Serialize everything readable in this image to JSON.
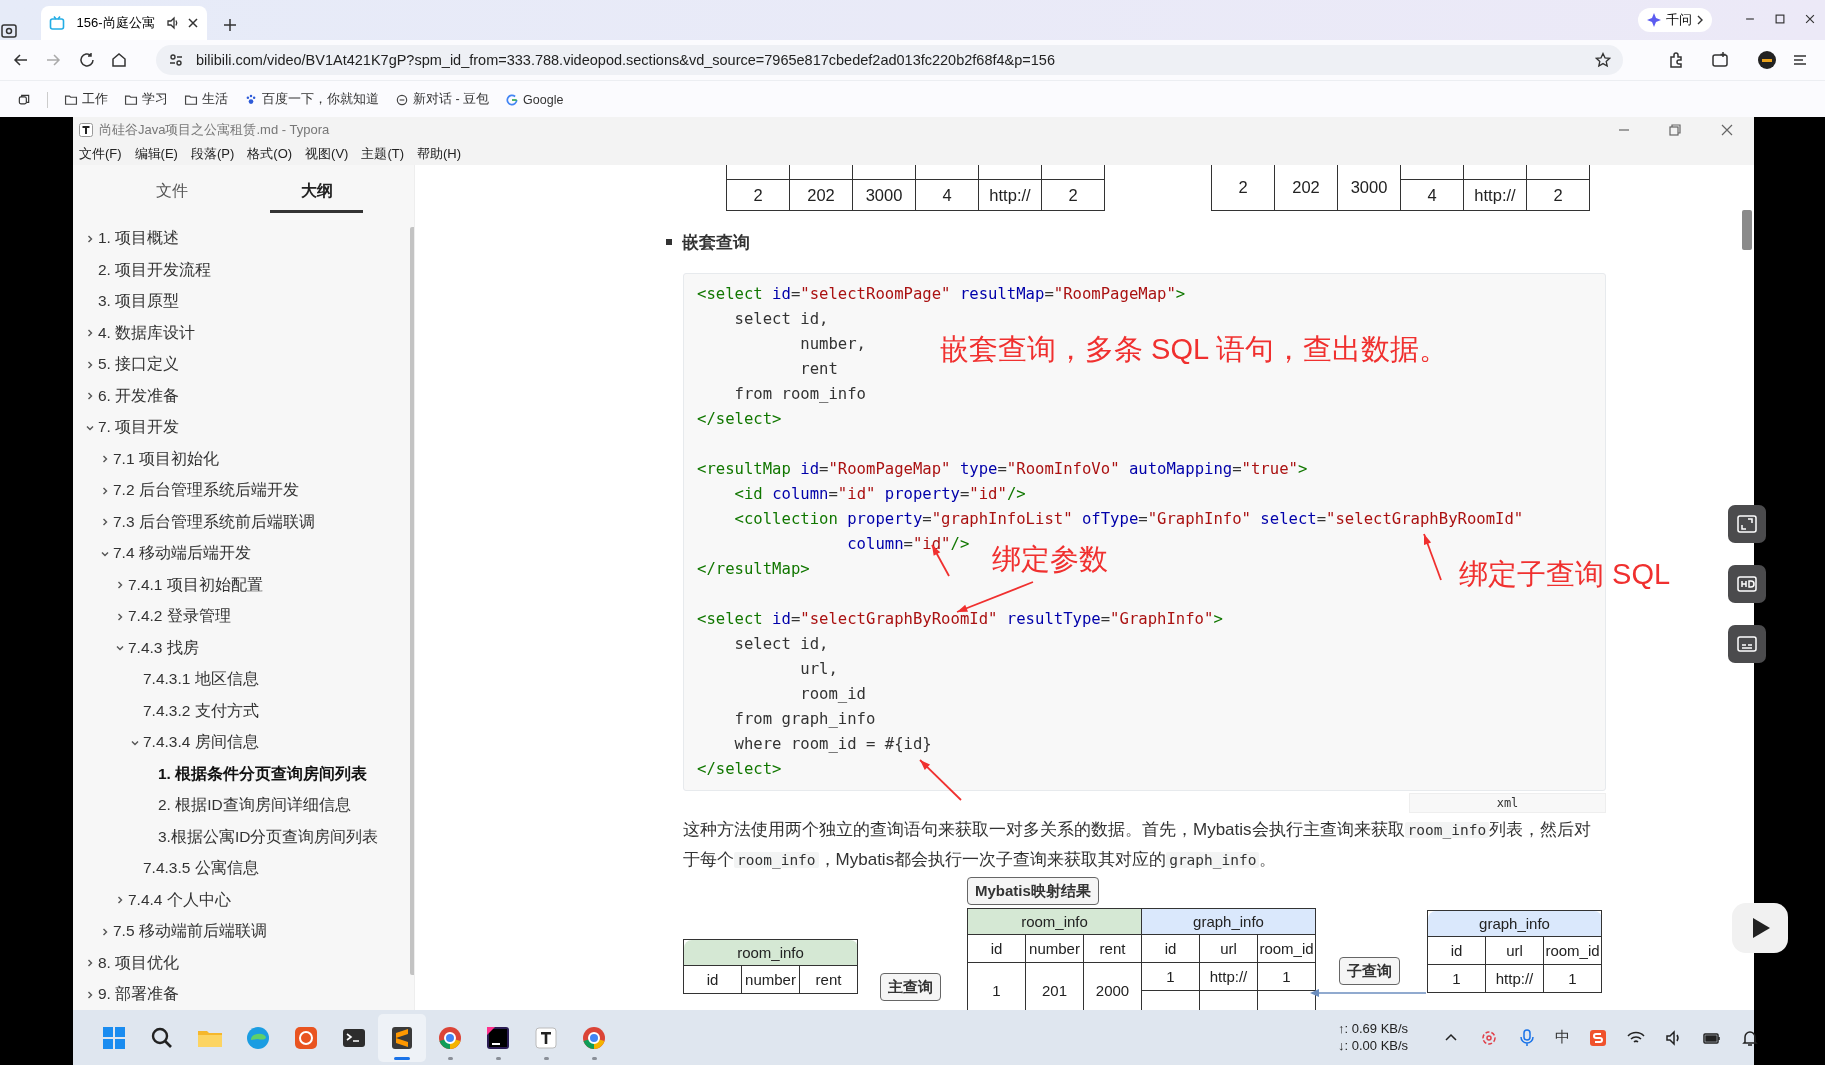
{
  "browser": {
    "tabs": [
      {
        "title": "156-尚庭公寓",
        "selected": true
      }
    ],
    "assistant_button": "千问",
    "address": "bilibili.com/video/BV1At421K7gP?spm_id_from=333.788.videopod.sections&vd_source=7965e817cbedef2ad013fc220b2f68f4&p=156",
    "bookmarks": [
      {
        "label": "工作",
        "kind": "folder"
      },
      {
        "label": "学习",
        "kind": "folder"
      },
      {
        "label": "生活",
        "kind": "folder"
      },
      {
        "label": "百度一下，你就知道",
        "kind": "paw"
      },
      {
        "label": "新对话 - 豆包",
        "kind": "chat"
      },
      {
        "label": "Google",
        "kind": "google"
      }
    ]
  },
  "typora": {
    "title": "尚硅谷Java项目之公寓租赁.md - Typora",
    "menu": [
      "文件(F)",
      "编辑(E)",
      "段落(P)",
      "格式(O)",
      "视图(V)",
      "主题(T)",
      "帮助(H)"
    ],
    "sidebar_tabs": [
      {
        "label": "文件",
        "selected": false
      },
      {
        "label": "大纲",
        "selected": true
      }
    ],
    "outline": [
      {
        "label": "1. 项目概述",
        "expanded": false,
        "selected": false
      },
      {
        "label": "2. 项目开发流程",
        "selected": false
      },
      {
        "label": "3. 项目原型",
        "selected": false
      },
      {
        "label": "4. 数据库设计",
        "expanded": false,
        "selected": false
      },
      {
        "label": "5. 接口定义",
        "expanded": false,
        "selected": false
      },
      {
        "label": "6. 开发准备",
        "expanded": false,
        "selected": false
      },
      {
        "label": "7. 项目开发",
        "expanded": true,
        "selected": false,
        "children": [
          {
            "label": "7.1 项目初始化",
            "expanded": false,
            "selected": false
          },
          {
            "label": "7.2 后台管理系统后端开发",
            "expanded": false,
            "selected": false
          },
          {
            "label": "7.3 后台管理系统前后端联调",
            "expanded": false,
            "selected": false
          },
          {
            "label": "7.4 移动端后端开发",
            "expanded": true,
            "selected": false,
            "children": [
              {
                "label": "7.4.1 项目初始配置",
                "expanded": false,
                "selected": false
              },
              {
                "label": "7.4.2 登录管理",
                "expanded": false,
                "selected": false
              },
              {
                "label": "7.4.3 找房",
                "expanded": true,
                "selected": false,
                "children": [
                  {
                    "label": "7.4.3.1 地区信息",
                    "selected": false
                  },
                  {
                    "label": "7.4.3.2 支付方式",
                    "selected": false
                  },
                  {
                    "label": "7.4.3.4 房间信息",
                    "expanded": true,
                    "selected": false,
                    "children": [
                      {
                        "label": "1. 根据条件分页查询房间列表",
                        "selected": true
                      },
                      {
                        "label": "2. 根据ID查询房间详细信息",
                        "selected": false
                      },
                      {
                        "label": "3.根据公寓ID分页查询房间列表",
                        "selected": false
                      }
                    ]
                  },
                  {
                    "label": "7.4.3.5 公寓信息",
                    "selected": false
                  }
                ]
              },
              {
                "label": "7.4.4 个人中心",
                "expanded": false,
                "selected": false
              }
            ]
          },
          {
            "label": "7.5 移动端前后端联调",
            "expanded": false,
            "selected": false
          }
        ]
      },
      {
        "label": "8. 项目优化",
        "expanded": false,
        "selected": false
      },
      {
        "label": "9. 部署准备",
        "expanded": false,
        "selected": false
      }
    ]
  },
  "document": {
    "top_tables": [
      {
        "kind": "plain",
        "rows": [
          [
            "2",
            "202",
            "3000",
            "4",
            "http://",
            "2"
          ]
        ]
      },
      {
        "kind": "merged",
        "merged": [
          "2",
          "202",
          "3000"
        ],
        "rows": [
          [
            "4",
            "http://",
            "2"
          ]
        ]
      }
    ],
    "heading": "嵌套查询",
    "code": {
      "language": "xml",
      "blocks": [
        [
          "<select id=\"selectRoomPage\" resultMap=\"RoomPageMap\">",
          "    select id,",
          "           number,",
          "           rent",
          "    from room_info",
          "</select>"
        ],
        [
          "<resultMap id=\"RoomPageMap\" type=\"RoomInfoVo\" autoMapping=\"true\">",
          "    <id column=\"id\" property=\"id\"/>",
          "    <collection property=\"graphInfoList\" ofType=\"GraphInfo\" select=\"selectGraphByRoomId\"",
          "                column=\"id\"/>",
          "</resultMap>"
        ],
        [
          "<select id=\"selectGraphByRoomId\" resultType=\"GraphInfo\">",
          "    select id,",
          "           url,",
          "           room_id",
          "    from graph_info",
          "    where room_id = #{id}",
          "</select>"
        ]
      ]
    },
    "annotations": [
      "嵌套查询，多条 SQL 语句，查出数据。",
      "绑定参数",
      "绑定子查询 SQL"
    ],
    "paragraph": [
      {
        "kind": "text",
        "text": "这种方法使用两个独立的查询语句来获取一对多关系的数据。首先，Mybatis会执行主查询来获取"
      },
      {
        "kind": "code",
        "text": "room_info"
      },
      {
        "kind": "text",
        "text": "列表，然后对于每个"
      },
      {
        "kind": "code",
        "text": "room_info"
      },
      {
        "kind": "text",
        "text": "，Mybatis都会执行一次子查询来获取其对应的"
      },
      {
        "kind": "code",
        "text": "graph_info"
      },
      {
        "kind": "text",
        "text": "。"
      }
    ],
    "diagram": {
      "result_label": "Mybatis映射结果",
      "joined": {
        "groups": [
          {
            "title": "room_info",
            "color": "#d5e8d4"
          },
          {
            "title": "graph_info",
            "color": "#dae8fc"
          }
        ],
        "columns": [
          "id",
          "number",
          "rent",
          "id",
          "url",
          "room_id"
        ],
        "rows": [
          [
            "1",
            "201",
            "2000",
            "1",
            "http://",
            "1"
          ]
        ]
      },
      "main_table": {
        "title": "room_info",
        "color": "#d5e8d4",
        "columns": [
          "id",
          "number",
          "rent"
        ]
      },
      "sub_table": {
        "title": "graph_info",
        "color": "#dae8fc",
        "columns": [
          "id",
          "url",
          "room_id"
        ],
        "rows": [
          [
            "1",
            "http://",
            "1"
          ]
        ]
      },
      "main_label": "主查询",
      "sub_label": "子查询"
    }
  },
  "taskbar": {
    "apps": [
      {
        "kind": "start",
        "running": false,
        "active": false
      },
      {
        "kind": "search",
        "running": false,
        "active": false
      },
      {
        "kind": "folder",
        "running": false,
        "active": false
      },
      {
        "kind": "edge",
        "running": false,
        "active": false
      },
      {
        "kind": "ubuntu",
        "running": false,
        "active": false
      },
      {
        "kind": "terminal",
        "running": false,
        "active": false
      },
      {
        "kind": "sublime",
        "running": true,
        "active": true
      },
      {
        "kind": "chrome",
        "running": true,
        "active": false
      },
      {
        "kind": "jetbrains",
        "running": true,
        "active": false
      },
      {
        "kind": "typora",
        "running": true,
        "active": false
      },
      {
        "kind": "chrome",
        "running": true,
        "active": false
      }
    ],
    "network": [
      "↑: 0.69 KB/s",
      "↓: 0.00 KB/s"
    ],
    "ime": "中"
  }
}
